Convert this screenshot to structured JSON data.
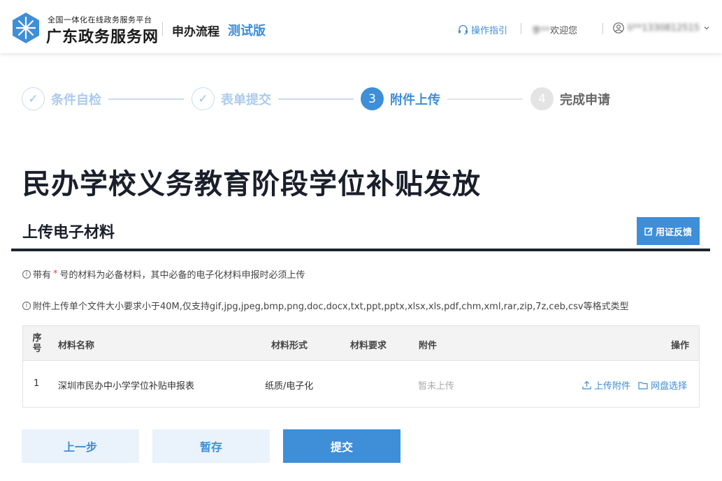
{
  "header": {
    "platform_subtitle": "全国一体化在线政务服务平台",
    "platform_title": "广东政务服务网",
    "nav_flow": "申办流程",
    "nav_test": "测试版",
    "guide_label": "操作指引",
    "welcome_name": "李**",
    "welcome_text": "欢迎您",
    "user_account": "li**1330812515"
  },
  "steps": [
    {
      "label": "条件自检",
      "status": "done",
      "mark": "✓"
    },
    {
      "label": "表单提交",
      "status": "done",
      "mark": "✓"
    },
    {
      "label": "附件上传",
      "status": "current",
      "mark": "3"
    },
    {
      "label": "完成申请",
      "status": "todo",
      "mark": "4"
    }
  ],
  "page_title": "民办学校义务教育阶段学位补贴发放",
  "section": {
    "title": "上传电子材料",
    "feedback_button": "用证反馈"
  },
  "notes": {
    "required_prefix": "带有",
    "required_star": "*",
    "required_suffix": "号的材料为必备材料，其中必备的电子化材料申报时必须上传",
    "file_rule": "附件上传单个文件大小要求小于40M,仅支持gif,jpg,jpeg,bmp,png,doc,docx,txt,ppt,pptx,xlsx,xls,pdf,chm,xml,rar,zip,7z,ceb,csv等格式类型"
  },
  "table": {
    "headers": {
      "index": "序号",
      "name": "材料名称",
      "form": "材料形式",
      "requirement": "材料要求",
      "attachment": "附件",
      "operation": "操作"
    },
    "rows": [
      {
        "index": "1",
        "name": "深圳市民办中小学学位补贴申报表",
        "form": "纸质/电子化",
        "requirement": "",
        "attachment": "暂未上传",
        "upload": "上传附件",
        "cloud": "网盘选择"
      }
    ]
  },
  "buttons": {
    "prev": "上一步",
    "save": "暂存",
    "submit": "提交"
  },
  "colors": {
    "accent": "#3e8ed8",
    "title_dark": "#1a1f2b",
    "required": "#e8483e"
  }
}
